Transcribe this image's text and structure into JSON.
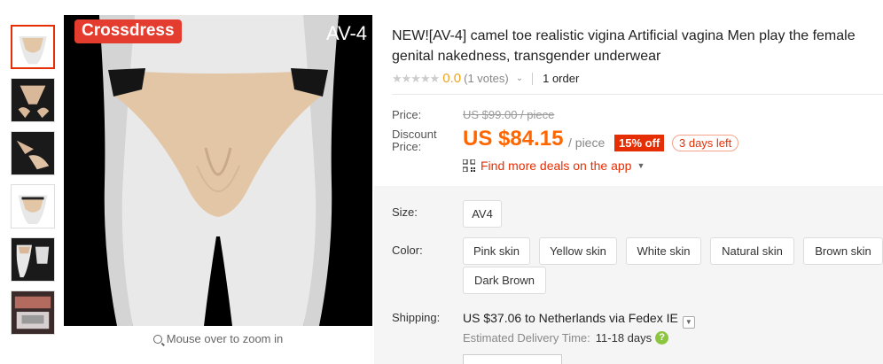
{
  "thumbnails": [
    {
      "name": "thumb-1",
      "active": true
    },
    {
      "name": "thumb-2"
    },
    {
      "name": "thumb-3"
    },
    {
      "name": "thumb-4"
    },
    {
      "name": "thumb-5"
    },
    {
      "name": "thumb-6"
    }
  ],
  "main_image": {
    "badge": "Crossdress",
    "model_tag": "AV-4",
    "zoom_hint": "Mouse over to zoom in"
  },
  "product": {
    "title": "NEW![AV-4] camel toe realistic vigina Artificial vagina Men play the female genital nakedness, transgender underwear",
    "rating": {
      "stars": "★★★★★",
      "score": "0.0",
      "votes": "(1 votes)",
      "orders": "1 order"
    },
    "price": {
      "label": "Price:",
      "original": "US $99.00 / piece",
      "discount_label_1": "Discount",
      "discount_label_2": "Price:",
      "current": "US $84.15",
      "unit": "/ piece",
      "off": "15% off",
      "time_left": "3 days left"
    },
    "app_deal": "Find more deals on the app"
  },
  "size": {
    "label": "Size:",
    "options": [
      "AV4"
    ]
  },
  "color": {
    "label": "Color:",
    "options": [
      "Pink skin",
      "Yellow skin",
      "White skin",
      "Natural skin",
      "Brown skin",
      "Dark Brown"
    ]
  },
  "shipping": {
    "label": "Shipping:",
    "value": "US $37.06 to Netherlands via Fedex IE",
    "est_label": "Estimated Delivery Time:",
    "est_value": "11-18  days",
    "help": "?"
  },
  "colors": {
    "accent": "#e62e04",
    "price": "#ff6600",
    "star_rating": "#f2a31a",
    "help_icon": "#8cc63f"
  }
}
